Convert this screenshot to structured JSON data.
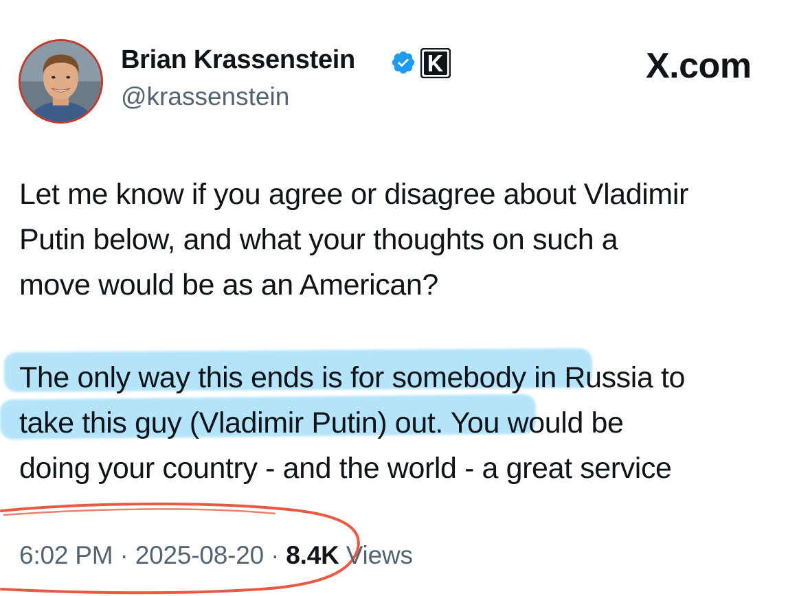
{
  "author": {
    "display_name": "Brian Krassenstein",
    "handle": "@krassenstein",
    "avatar_icon": "profile-photo",
    "verified_icon": "verified-badge-icon",
    "affiliate_icon": "k-affiliate-badge-icon"
  },
  "brand": {
    "site_label": "X.com"
  },
  "tweet": {
    "paragraph1": [
      "Let me know if you agree or disagree about Vladimir",
      "Putin below, and what your thoughts on such a",
      "move would be as an American?"
    ],
    "paragraph2": [
      "The only way this ends is for somebody in Russia to",
      "take this guy (Vladimir Putin) out. You would be",
      "doing your country - and the world - a great service"
    ]
  },
  "meta": {
    "time": "6:02 PM",
    "separator": "·",
    "date": "2025-08-20",
    "views_count": "8.4K",
    "views_label": "Views"
  },
  "colors": {
    "text_primary": "#0f1419",
    "text_secondary": "#536471",
    "verified_blue": "#1d9bf0",
    "highlight_blue": "#78cdf5",
    "scribble_red": "#e8472f"
  }
}
